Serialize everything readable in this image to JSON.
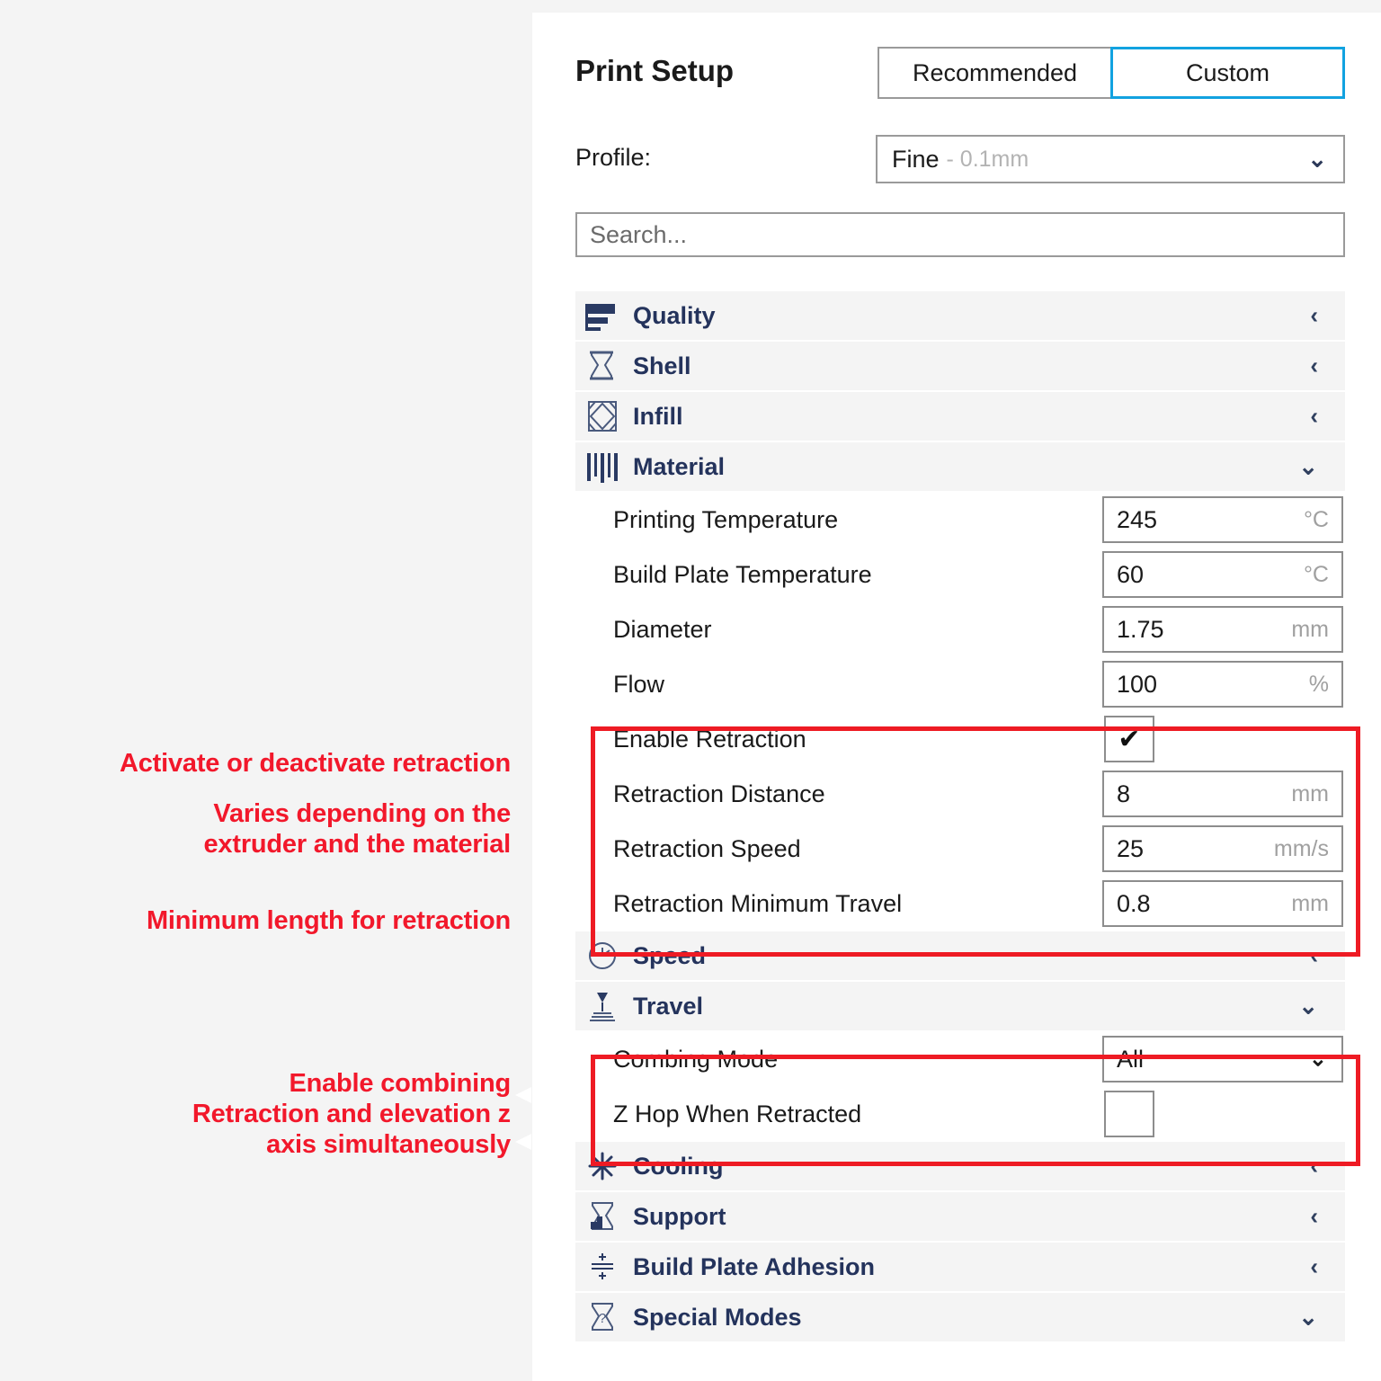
{
  "header": {
    "title": "Print Setup",
    "modes": [
      {
        "label": "Recommended",
        "active": false
      },
      {
        "label": "Custom",
        "active": true
      }
    ],
    "profile_label": "Profile:",
    "profile_value": "Fine",
    "profile_detail": "- 0.1mm",
    "chevron": "⌄"
  },
  "search": {
    "placeholder": "Search..."
  },
  "sections": [
    {
      "name": "Quality",
      "icon": "quality-icon",
      "expanded": false,
      "chevron": "‹"
    },
    {
      "name": "Shell",
      "icon": "shell-icon",
      "expanded": false,
      "chevron": "‹"
    },
    {
      "name": "Infill",
      "icon": "infill-icon",
      "expanded": false,
      "chevron": "‹"
    },
    {
      "name": "Material",
      "icon": "material-icon",
      "expanded": true,
      "chevron": "⌄"
    },
    {
      "name": "Speed",
      "icon": "speed-icon",
      "expanded": false,
      "chevron": "‹"
    },
    {
      "name": "Travel",
      "icon": "travel-icon",
      "expanded": true,
      "chevron": "⌄"
    },
    {
      "name": "Cooling",
      "icon": "cooling-icon",
      "expanded": false,
      "chevron": "‹"
    },
    {
      "name": "Support",
      "icon": "support-icon",
      "expanded": false,
      "chevron": "‹"
    },
    {
      "name": "Build Plate Adhesion",
      "icon": "build-plate-adhesion-icon",
      "expanded": false,
      "chevron": "‹"
    },
    {
      "name": "Special Modes",
      "icon": "special-modes-icon",
      "expanded": true,
      "chevron": "⌄"
    }
  ],
  "material_settings": [
    {
      "label": "Printing Temperature",
      "value": "245",
      "unit": "°C",
      "type": "number"
    },
    {
      "label": "Build Plate Temperature",
      "value": "60",
      "unit": "°C",
      "type": "number"
    },
    {
      "label": "Diameter",
      "value": "1.75",
      "unit": "mm",
      "type": "number"
    },
    {
      "label": "Flow",
      "value": "100",
      "unit": "%",
      "type": "number"
    },
    {
      "label": "Enable Retraction",
      "value": "✔",
      "unit": "",
      "type": "checkbox",
      "checked": true
    },
    {
      "label": "Retraction Distance",
      "value": "8",
      "unit": "mm",
      "type": "number"
    },
    {
      "label": "Retraction Speed",
      "value": "25",
      "unit": "mm/s",
      "type": "number"
    },
    {
      "label": "Retraction Minimum Travel",
      "value": "0.8",
      "unit": "mm",
      "type": "number"
    }
  ],
  "travel_settings": [
    {
      "label": "Combing Mode",
      "value": "All",
      "unit": "",
      "type": "select",
      "chevron": "⌄"
    },
    {
      "label": "Z Hop When Retracted",
      "value": "",
      "unit": "",
      "type": "checkbox",
      "checked": false
    }
  ],
  "annotations": [
    {
      "id": "a1",
      "text": "Activate or deactivate retraction"
    },
    {
      "id": "a2",
      "text": "Varies depending on the\nextruder and the material"
    },
    {
      "id": "a3",
      "text": "Minimum length for retraction"
    },
    {
      "id": "a4",
      "text": "Enable combining\nRetraction and elevation z\naxis simultaneously"
    }
  ],
  "colors": {
    "accent_blue": "#12a2e0",
    "annotation_red": "#ee1b24",
    "section_text": "#24335c",
    "panel_bg": "#ffffff",
    "outer_bg": "#f4f4f4"
  }
}
